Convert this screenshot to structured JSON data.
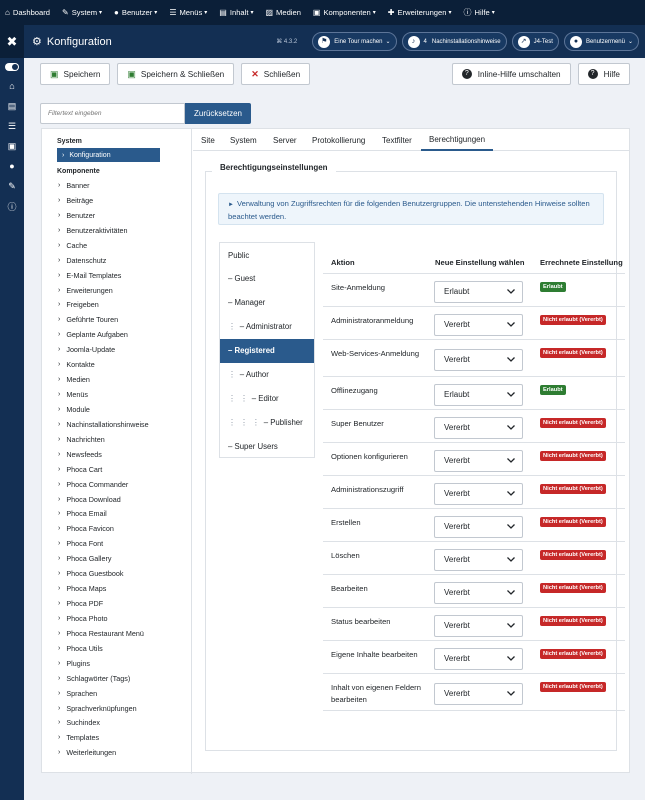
{
  "topmenu": [
    {
      "label": "Dashboard",
      "icon": "home-icon",
      "caret": false
    },
    {
      "label": "System",
      "icon": "wrench-icon",
      "caret": true
    },
    {
      "label": "Benutzer",
      "icon": "users-icon",
      "caret": true
    },
    {
      "label": "Menüs",
      "icon": "menu-icon",
      "caret": true
    },
    {
      "label": "Inhalt",
      "icon": "file-icon",
      "caret": true
    },
    {
      "label": "Medien",
      "icon": "image-icon",
      "caret": false
    },
    {
      "label": "Komponenten",
      "icon": "cubes-icon",
      "caret": true
    },
    {
      "label": "Erweiterungen",
      "icon": "puzzle-icon",
      "caret": true
    },
    {
      "label": "Hilfe",
      "icon": "info-icon",
      "caret": true
    }
  ],
  "header": {
    "title": "Konfiguration",
    "version": "⌘ 4.3.2",
    "tour_label": "Eine Tour machen",
    "notif_count": "4",
    "notif_label": "Nachinstallationshinweise",
    "site_label": "J4-Test",
    "user_label": "Benutzermenü"
  },
  "toolbar": {
    "save": "Speichern",
    "save_close": "Speichern & Schließen",
    "close": "Schließen",
    "inline_help": "Inline-Hilfe umschalten",
    "help": "Hilfe"
  },
  "filter": {
    "placeholder": "Filtertext eingeben",
    "reset": "Zurücksetzen"
  },
  "nav": {
    "system_heading": "System",
    "config_item": "Konfiguration",
    "component_heading": "Komponente",
    "items": [
      "Banner",
      "Beiträge",
      "Benutzer",
      "Benutzeraktivitäten",
      "Cache",
      "Datenschutz",
      "E-Mail Templates",
      "Erweiterungen",
      "Freigeben",
      "Geführte Touren",
      "Geplante Aufgaben",
      "Joomla-Update",
      "Kontakte",
      "Medien",
      "Menüs",
      "Module",
      "Nachinstallationshinweise",
      "Nachrichten",
      "Newsfeeds",
      "Phoca Cart",
      "Phoca Commander",
      "Phoca Download",
      "Phoca Email",
      "Phoca Favicon",
      "Phoca Font",
      "Phoca Gallery",
      "Phoca Guestbook",
      "Phoca Maps",
      "Phoca PDF",
      "Phoca Photo",
      "Phoca Restaurant Menü",
      "Phoca Utils",
      "Plugins",
      "Schlagwörter (Tags)",
      "Sprachen",
      "Sprachverknüpfungen",
      "Suchindex",
      "Templates",
      "Weiterleitungen"
    ]
  },
  "tabs": [
    "Site",
    "System",
    "Server",
    "Protokollierung",
    "Textfilter",
    "Berechtigungen"
  ],
  "active_tab": "Berechtigungen",
  "permissions": {
    "legend": "Berechtigungseinstellungen",
    "notice": "Verwaltung von Zugriffsrechten für die folgenden Benutzergruppen. Die untenstehenden Hinweise sollten beachtet werden.",
    "groups": [
      {
        "dots": "",
        "label": "Public"
      },
      {
        "dots": "",
        "label": "– Guest"
      },
      {
        "dots": "",
        "label": "– Manager"
      },
      {
        "dots": "⋮",
        "label": "– Administrator"
      },
      {
        "dots": "",
        "label": "– Registered"
      },
      {
        "dots": "⋮",
        "label": "– Author"
      },
      {
        "dots": "⋮ ⋮",
        "label": "– Editor"
      },
      {
        "dots": "⋮ ⋮ ⋮",
        "label": "– Publisher"
      },
      {
        "dots": "",
        "label": "– Super Users"
      }
    ],
    "selected_group": "– Registered",
    "col_action": "Aktion",
    "col_new": "Neue Einstellung wählen",
    "col_calc": "Errechnete Einstellung",
    "rows": [
      {
        "action": "Site-Anmeldung",
        "setting": "Erlaubt",
        "calc": "Erlaubt",
        "status": "ok"
      },
      {
        "action": "Administratoranmeldung",
        "setting": "Vererbt",
        "calc": "Nicht erlaubt (Vererbt)",
        "status": "no"
      },
      {
        "action": "Web-Services-Anmeldung",
        "setting": "Vererbt",
        "calc": "Nicht erlaubt (Vererbt)",
        "status": "no"
      },
      {
        "action": "Offlinezugang",
        "setting": "Erlaubt",
        "calc": "Erlaubt",
        "status": "ok"
      },
      {
        "action": "Super Benutzer",
        "setting": "Vererbt",
        "calc": "Nicht erlaubt (Vererbt)",
        "status": "no"
      },
      {
        "action": "Optionen konfigurieren",
        "setting": "Vererbt",
        "calc": "Nicht erlaubt (Vererbt)",
        "status": "no"
      },
      {
        "action": "Administrationszugriff",
        "setting": "Vererbt",
        "calc": "Nicht erlaubt (Vererbt)",
        "status": "no"
      },
      {
        "action": "Erstellen",
        "setting": "Vererbt",
        "calc": "Nicht erlaubt (Vererbt)",
        "status": "no"
      },
      {
        "action": "Löschen",
        "setting": "Vererbt",
        "calc": "Nicht erlaubt (Vererbt)",
        "status": "no"
      },
      {
        "action": "Bearbeiten",
        "setting": "Vererbt",
        "calc": "Nicht erlaubt (Vererbt)",
        "status": "no"
      },
      {
        "action": "Status bearbeiten",
        "setting": "Vererbt",
        "calc": "Nicht erlaubt (Vererbt)",
        "status": "no"
      },
      {
        "action": "Eigene Inhalte bearbeiten",
        "setting": "Vererbt",
        "calc": "Nicht erlaubt (Vererbt)",
        "status": "no"
      },
      {
        "action": "Inhalt von eigenen Feldern bearbeiten",
        "setting": "Vererbt",
        "calc": "Nicht erlaubt (Vererbt)",
        "status": "no"
      }
    ]
  },
  "colors": {
    "navy": "#132f53",
    "topbar": "#0b1f38",
    "accent": "#2a5a8c",
    "allowed": "#2e7d32",
    "denied": "#c62828"
  }
}
